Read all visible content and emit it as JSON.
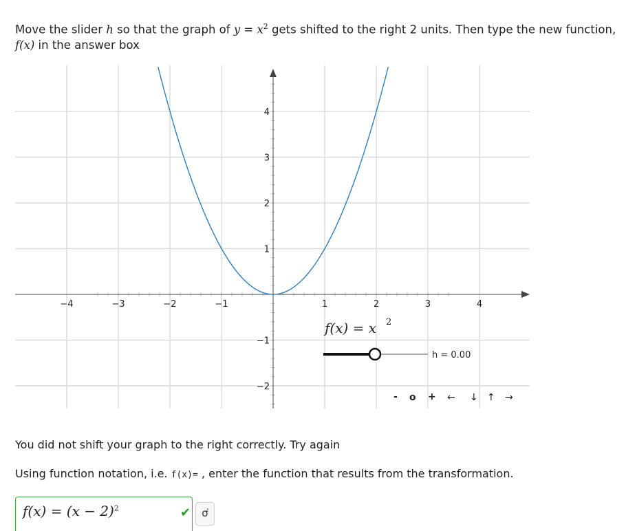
{
  "question": {
    "part1": "Move the slider ",
    "h_var": "h",
    "part2": " so that the graph of ",
    "eq_lhs": "y",
    "eq_mid": " = ",
    "eq_rhs": "x",
    "eq_exp": "2",
    "part3": " gets shifted to the right 2 units. Then type the new function,",
    "fx": "f",
    "fx_arg": "(x)",
    "part4": " in the answer box"
  },
  "graph": {
    "x_ticks": [
      "−4",
      "−3",
      "−2",
      "−1",
      "1",
      "2",
      "3",
      "4"
    ],
    "y_ticks": [
      "4",
      "3",
      "2",
      "1",
      "−1",
      "−2"
    ],
    "curve_color": "#2f7dbd",
    "function_label": "f(x) = x",
    "function_label_exp": "2",
    "slider_label": "h = 0.00",
    "slider_value": 0.0,
    "slider_range": [
      -2,
      2
    ],
    "controls": {
      "minus": "-",
      "reset": "o",
      "plus": "+",
      "left": "←",
      "down": "↓",
      "up": "↑",
      "right": "→"
    }
  },
  "feedback": "You did not shift your graph to the right correctly. Try again",
  "instruction": {
    "before": "Using function notation, i.e. ",
    "code": "f(x)=",
    "after": " , enter the function that results from the transformation."
  },
  "answer": {
    "value": "f(x) = (x − 2)",
    "exp": "2"
  },
  "icons": {
    "check": "✔",
    "symbol_button": "σ͘"
  }
}
